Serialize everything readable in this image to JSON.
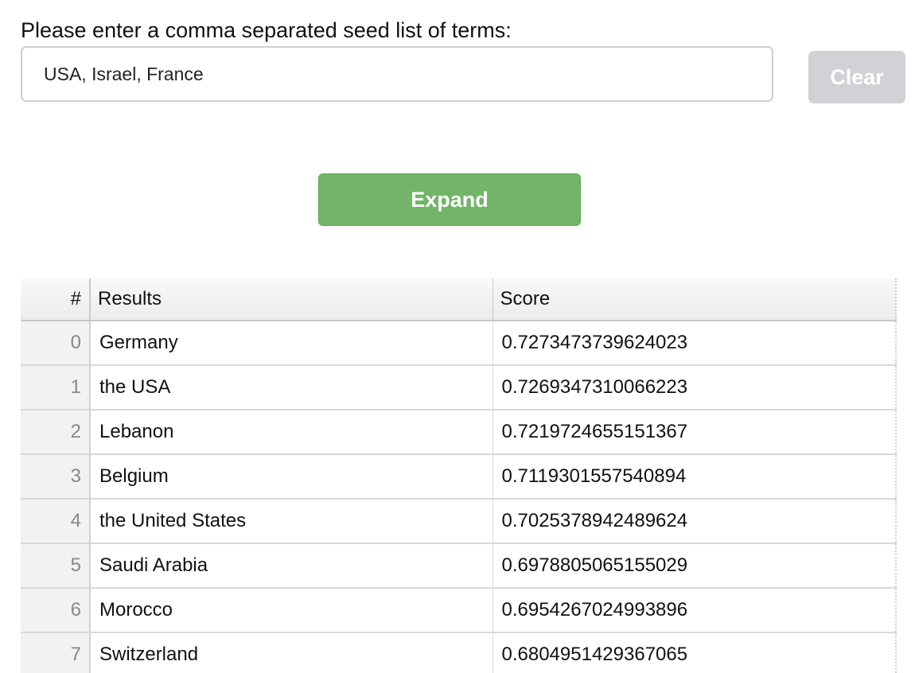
{
  "form": {
    "prompt": "Please enter a comma separated seed list of terms:",
    "seed_value": "USA, Israel, France",
    "clear_label": "Clear",
    "expand_label": "Expand"
  },
  "table": {
    "headers": {
      "index": "#",
      "results": "Results",
      "score": "Score"
    },
    "rows": [
      {
        "index": "0",
        "result": "Germany",
        "score": "0.7273473739624023"
      },
      {
        "index": "1",
        "result": "the USA",
        "score": "0.7269347310066223"
      },
      {
        "index": "2",
        "result": "Lebanon",
        "score": "0.7219724655151367"
      },
      {
        "index": "3",
        "result": "Belgium",
        "score": "0.7119301557540894"
      },
      {
        "index": "4",
        "result": "the United States",
        "score": "0.7025378942489624"
      },
      {
        "index": "5",
        "result": "Saudi Arabia",
        "score": "0.6978805065155029"
      },
      {
        "index": "6",
        "result": "Morocco",
        "score": "0.6954267024993896"
      },
      {
        "index": "7",
        "result": "Switzerland",
        "score": "0.6804951429367065"
      }
    ]
  },
  "colors": {
    "expand_button": "#72b568",
    "clear_button": "#d1d1d6",
    "index_cell_bg": "#f2f2f2"
  }
}
